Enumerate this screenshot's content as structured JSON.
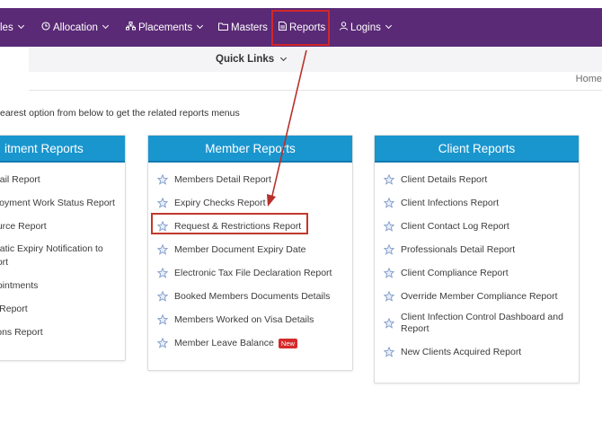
{
  "nav": {
    "items": [
      {
        "label": "les",
        "icon": "",
        "chevron": true
      },
      {
        "label": "Allocation",
        "icon": "clock-icon",
        "chevron": true
      },
      {
        "label": "Placements",
        "icon": "sitemap-icon",
        "chevron": true
      },
      {
        "label": "Masters",
        "icon": "folder-icon",
        "chevron": false
      },
      {
        "label": "Reports",
        "icon": "report-icon",
        "chevron": false
      },
      {
        "label": "Logins",
        "icon": "user-icon",
        "chevron": true
      }
    ]
  },
  "quick_links": {
    "label": "Quick Links"
  },
  "breadcrumb": {
    "home": "Home"
  },
  "instruction": "earest option from below to get the related reports menus",
  "cards": {
    "left": {
      "title": "itment Reports",
      "items": [
        "etail Report",
        "ployment Work Status Report",
        "ource Report",
        "matic Expiry Notification to",
        "port",
        "pointments",
        "y Report",
        "tions Report"
      ]
    },
    "middle": {
      "title": "Member Reports",
      "items": [
        "Members Detail Report",
        "Expiry Checks Report",
        "Request & Restrictions Report",
        "Member Document Expiry Date",
        "Electronic Tax File Declaration Report",
        "Booked Members Documents Details",
        "Members Worked on Visa Details",
        "Member Leave Balance"
      ],
      "new_badge": "New"
    },
    "right": {
      "title": "Client Reports",
      "items": [
        "Client Details Report",
        "Client Infections Report",
        "Client Contact Log Report",
        "Professionals Detail Report",
        "Client Compliance Report",
        "Override Member Compliance Report",
        "Client Infection Control Dashboard and",
        "Report",
        "New Clients Acquired Report"
      ]
    },
    "icon": "star-icon"
  },
  "colors": {
    "navbar": "#5a2a76",
    "card_header": "#1a96cf",
    "highlight": "#d1272a",
    "star": "#7f9bc9",
    "new_badge": "#d62a2a"
  }
}
